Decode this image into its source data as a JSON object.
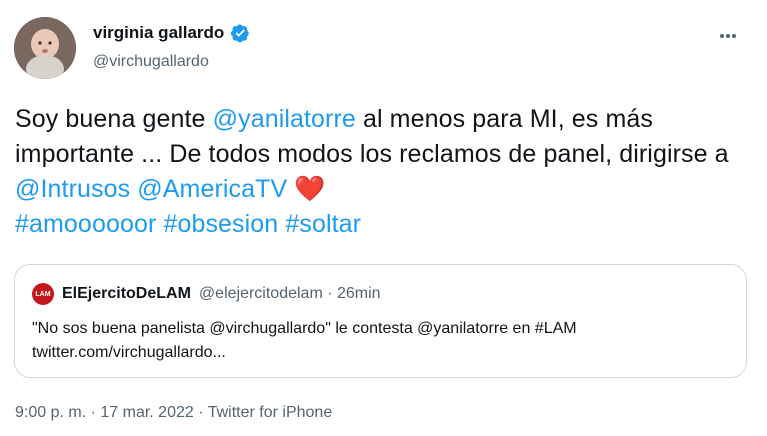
{
  "author": {
    "display_name": "virginia gallardo",
    "handle": "@virchugallardo",
    "verified_icon": "verified-badge-icon"
  },
  "more_icon": "more-horizontal-icon",
  "tweet": {
    "parts": [
      "Soy buena gente ",
      "@yanilatorre",
      "  al menos para MI, es más importante ... De todos modos los reclamos de panel, dirigirse a ",
      "@Intrusos",
      " ",
      "@AmericaTV",
      " ",
      "❤️",
      "#amoooooor",
      " ",
      "#obsesion",
      " ",
      "#soltar"
    ]
  },
  "quote": {
    "avatar_text": "LAM",
    "display_name": "ElEjercitoDeLAM",
    "meta": "@elejercitodelam · 26min",
    "line1": "\"No sos buena panelista @virchugallardo\" le contesta @yanilatorre en #LAM",
    "line2": "twitter.com/virchugallardo..."
  },
  "footer": {
    "time": "9:00 p. m.",
    "sep": " · ",
    "date": "17 mar. 2022",
    "sep2": " · ",
    "source": "Twitter for iPhone"
  },
  "colors": {
    "link": "#1d9bf0",
    "secondary_text": "#536471",
    "heart": "#e0245e",
    "border": "#cfd9de"
  }
}
